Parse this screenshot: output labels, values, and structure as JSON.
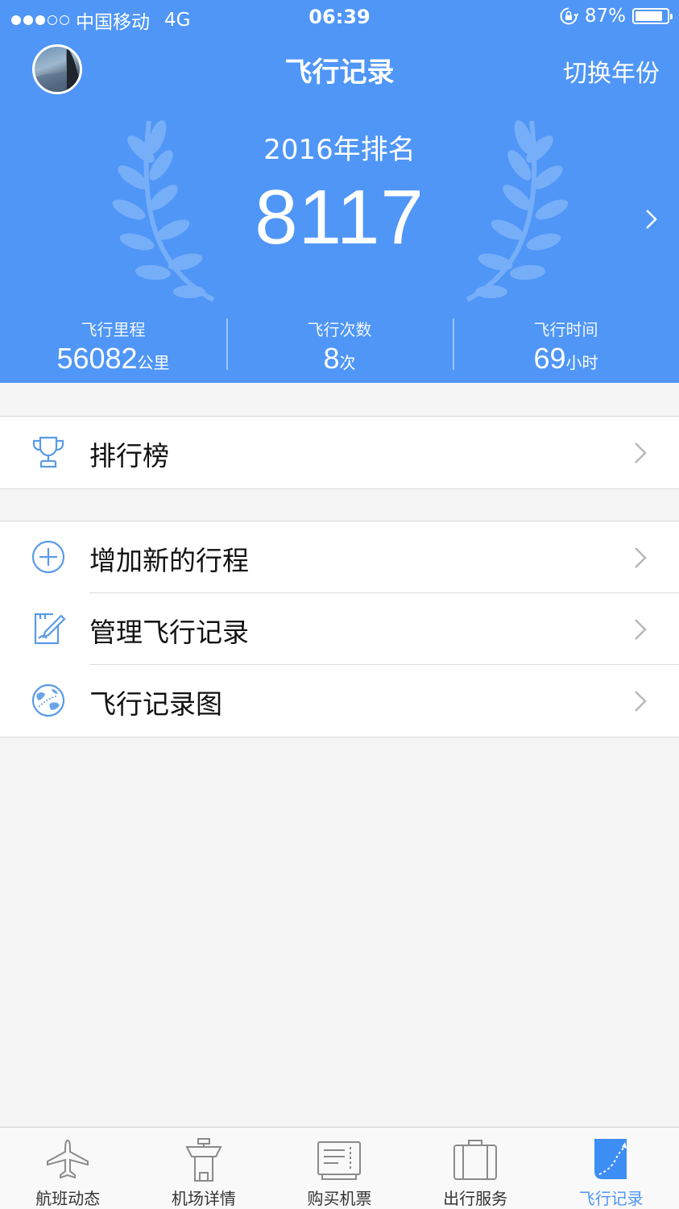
{
  "status_bar": {
    "carrier": "中国移动",
    "network": "4G",
    "time": "06:39",
    "battery": "87%",
    "battery_level": 0.87
  },
  "nav": {
    "title": "飞行记录",
    "action": "切换年份"
  },
  "ranking": {
    "title": "2016年排名",
    "value": "8117"
  },
  "stats": [
    {
      "label": "飞行里程",
      "value": "56082",
      "unit": "公里"
    },
    {
      "label": "飞行次数",
      "value": "8",
      "unit": "次"
    },
    {
      "label": "飞行时间",
      "value": "69",
      "unit": "小时"
    }
  ],
  "menu_group_1": [
    {
      "label": "排行榜",
      "icon": "trophy-icon"
    }
  ],
  "menu_group_2": [
    {
      "label": "增加新的行程",
      "icon": "plus-circle-icon"
    },
    {
      "label": "管理飞行记录",
      "icon": "edit-note-icon"
    },
    {
      "label": "飞行记录图",
      "icon": "globe-icon"
    }
  ],
  "tabbar": [
    {
      "label": "航班动态",
      "icon": "airplane-icon",
      "active": false
    },
    {
      "label": "机场详情",
      "icon": "control-tower-icon",
      "active": false
    },
    {
      "label": "购买机票",
      "icon": "ticket-icon",
      "active": false
    },
    {
      "label": "出行服务",
      "icon": "suitcase-icon",
      "active": false
    },
    {
      "label": "飞行记录",
      "icon": "flight-path-icon",
      "active": true
    }
  ],
  "colors": {
    "primary": "#4f96f7",
    "icon_blue": "#5a9be6",
    "tab_inactive": "#8a8a8a",
    "background": "#f5f5f5"
  }
}
